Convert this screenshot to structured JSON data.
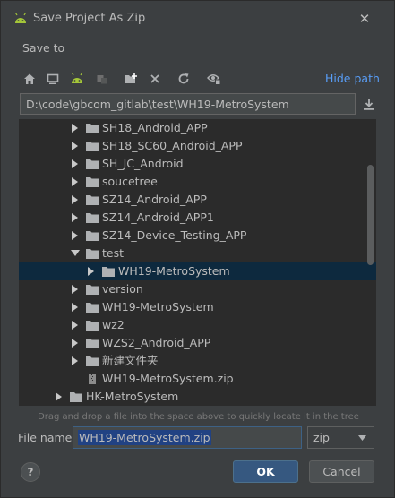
{
  "window": {
    "title": "Save Project As Zip",
    "close_glyph": "✕"
  },
  "save_to_label": "Save to",
  "toolbar": {
    "buttons": [
      "home-icon",
      "desktop-icon",
      "android-icon",
      "module-icon",
      "new-folder-icon",
      "delete-icon",
      "refresh-icon",
      "show-hidden-icon"
    ],
    "hide_path_label": "Hide path"
  },
  "path_value": "D:\\code\\gbcom_gitlab\\test\\WH19-MetroSystem",
  "tree": [
    {
      "label": "SH18_Android_APP",
      "depth": 2,
      "type": "folder",
      "expanded": false
    },
    {
      "label": "SH18_SC60_Android_APP",
      "depth": 2,
      "type": "folder",
      "expanded": false
    },
    {
      "label": "SH_JC_Android",
      "depth": 2,
      "type": "folder",
      "expanded": false
    },
    {
      "label": "soucetree",
      "depth": 2,
      "type": "folder",
      "expanded": false
    },
    {
      "label": "SZ14_Android_APP",
      "depth": 2,
      "type": "folder",
      "expanded": false
    },
    {
      "label": "SZ14_Android_APP1",
      "depth": 2,
      "type": "folder",
      "expanded": false
    },
    {
      "label": "SZ14_Device_Testing_APP",
      "depth": 2,
      "type": "folder",
      "expanded": false
    },
    {
      "label": "test",
      "depth": 2,
      "type": "folder",
      "expanded": true
    },
    {
      "label": "WH19-MetroSystem",
      "depth": 3,
      "type": "folder",
      "expanded": false,
      "selected": true
    },
    {
      "label": "version",
      "depth": 2,
      "type": "folder",
      "expanded": false
    },
    {
      "label": "WH19-MetroSystem",
      "depth": 2,
      "type": "folder",
      "expanded": false
    },
    {
      "label": "wz2",
      "depth": 2,
      "type": "folder",
      "expanded": false
    },
    {
      "label": "WZS2_Android_APP",
      "depth": 2,
      "type": "folder",
      "expanded": false
    },
    {
      "label": "新建文件夹",
      "depth": 2,
      "type": "folder",
      "expanded": false
    },
    {
      "label": "WH19-MetroSystem.zip",
      "depth": 2,
      "type": "zip",
      "expanded": false
    },
    {
      "label": "HK-MetroSystem",
      "depth": 1,
      "type": "folder",
      "expanded": false
    }
  ],
  "hint": "Drag and drop a file into the space above to quickly locate it in the tree",
  "file_name": {
    "label": "File name:",
    "value": "WH19-MetroSystem.zip"
  },
  "extension": {
    "selected": "zip"
  },
  "buttons": {
    "help": "?",
    "ok": "OK",
    "cancel": "Cancel"
  },
  "colors": {
    "accent": "#589df6",
    "selection": "#0d293e",
    "ok_button": "#365880",
    "folder": "#afb1b3",
    "android": "#a4c639"
  }
}
